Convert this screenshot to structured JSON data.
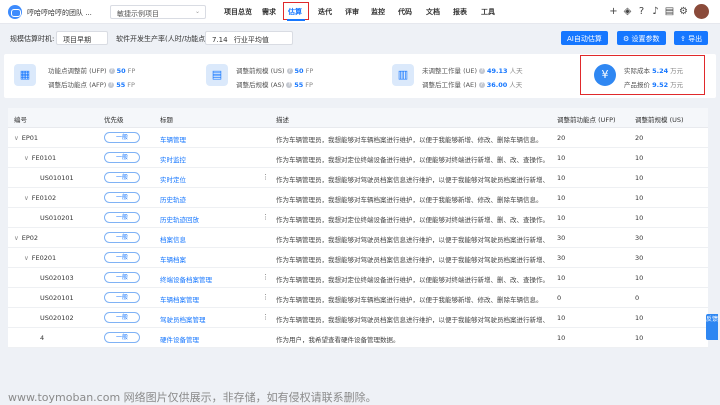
{
  "nav": {
    "team_name": "哼哈哼哈哼的团队 ...",
    "project_select": "敏捷示例项目",
    "tabs": [
      "项目总览",
      "需求",
      "估算",
      "迭代",
      "评审",
      "监控",
      "代码",
      "文档",
      "报表",
      "工具"
    ],
    "active_tab": "估算"
  },
  "filters": {
    "timing_label": "规模估算时机:",
    "timing_value": "项目早期",
    "rate_label": "软件开发生产率(人时/功能点):",
    "rate_value": "7.14",
    "rate_desc": "行业平均值",
    "ai_button": "AI自动估算",
    "settings_button": "设置参数",
    "export_button": "导出"
  },
  "summary": {
    "ufp_label": "功能点调整前 (UFP)",
    "ufp_value": "50",
    "ufp_unit": "FP",
    "afp_label": "调整后功能点 (AFP)",
    "afp_value": "55",
    "afp_unit": "FP",
    "us_label": "调整前规模 (US)",
    "us_value": "50",
    "us_unit": "FP",
    "as_label": "调整后规模 (AS)",
    "as_value": "55",
    "as_unit": "FP",
    "ue_label": "未调整工作量 (UE)",
    "ue_value": "49.13",
    "ue_unit": "人天",
    "ae_label": "调整后工作量 (AE)",
    "ae_value": "36.00",
    "ae_unit": "人天",
    "cost_label": "实际成本",
    "cost_value": "5.24",
    "cost_unit": "万元",
    "price_label": "产品报价",
    "price_value": "9.52",
    "price_unit": "万元"
  },
  "table": {
    "headers": [
      "编号",
      "优先级",
      "标题",
      "描述",
      "调整前功能点 (UFP)",
      "调整前规模 (US)"
    ],
    "rows": [
      {
        "id": "EP01",
        "indent": 0,
        "caret": "∨",
        "priority": "一般",
        "title": "车辆管理",
        "desc": "作为车辆管理员，我想能够对车辆档案进行维护，以便于我能够新增、修改、删除车辆信息。",
        "ufp": "20",
        "us": "20",
        "dots": false
      },
      {
        "id": "FE0101",
        "indent": 1,
        "caret": "∨",
        "priority": "一般",
        "title": "实时监控",
        "desc": "作为车辆管理员，我想对定位终端设备进行维护，以便能够对终端进行新增、删、改、查操作。",
        "ufp": "10",
        "us": "10",
        "dots": false
      },
      {
        "id": "US010101",
        "indent": 2,
        "caret": "",
        "priority": "一般",
        "title": "实时定位",
        "desc": "作为车辆管理员，我想能够对驾驶员档案信息进行维护，以便于我能够对驾驶员档案进行新增、修改",
        "ufp": "10",
        "us": "10",
        "dots": true
      },
      {
        "id": "FE0102",
        "indent": 1,
        "caret": "∨",
        "priority": "一般",
        "title": "历史轨迹",
        "desc": "作为车辆管理员，我想能够对车辆档案进行维护，以便于我能够新增、修改、删除车辆信息。",
        "ufp": "10",
        "us": "10",
        "dots": false
      },
      {
        "id": "US010201",
        "indent": 2,
        "caret": "",
        "priority": "一般",
        "title": "历史轨迹回放",
        "desc": "作为车辆管理员，我想对定位终端设备进行维护，以便能够对终端进行新增、删、改、查操作。",
        "ufp": "10",
        "us": "10",
        "dots": true
      },
      {
        "id": "EP02",
        "indent": 0,
        "caret": "∨",
        "priority": "一般",
        "title": "档案信息",
        "desc": "作为车辆管理员，我想能够对驾驶员档案信息进行维护，以便于我能够对驾驶员档案进行新增、修改",
        "ufp": "30",
        "us": "30",
        "dots": false
      },
      {
        "id": "FE0201",
        "indent": 1,
        "caret": "∨",
        "priority": "一般",
        "title": "车辆档案",
        "desc": "作为车辆管理员，我想能够对驾驶员档案信息进行维护，以便于我能够对驾驶员档案进行新增、修改",
        "ufp": "30",
        "us": "30",
        "dots": false
      },
      {
        "id": "US020103",
        "indent": 2,
        "caret": "",
        "priority": "一般",
        "title": "终端设备档案管理",
        "desc": "作为车辆管理员，我想对定位终端设备进行维护，以便能够对终端进行新增、删、改、查操作。",
        "ufp": "10",
        "us": "10",
        "dots": true
      },
      {
        "id": "US020101",
        "indent": 2,
        "caret": "",
        "priority": "一般",
        "title": "车辆档案管理",
        "desc": "作为车辆管理员，我想能够对车辆档案进行维护，以便于我能够新增、修改、删除车辆信息。",
        "ufp": "0",
        "us": "0",
        "dots": true
      },
      {
        "id": "US020102",
        "indent": 2,
        "caret": "",
        "priority": "一般",
        "title": "驾驶员档案管理",
        "desc": "作为车辆管理员，我想能够对驾驶员档案信息进行维护，以便于我能够对驾驶员档案进行新增、修改",
        "ufp": "10",
        "us": "10",
        "dots": true
      },
      {
        "id": "4",
        "indent": 2,
        "caret": "",
        "priority": "一般",
        "title": "硬件设备管理",
        "desc": "作为用户，我希望查看硬件设备管理数据。",
        "ufp": "10",
        "us": "10",
        "dots": false
      }
    ]
  },
  "sidetab": "反馈",
  "watermark": "www.toymoban.com 网络图片仅供展示，非存储，如有侵权请联系删除。"
}
